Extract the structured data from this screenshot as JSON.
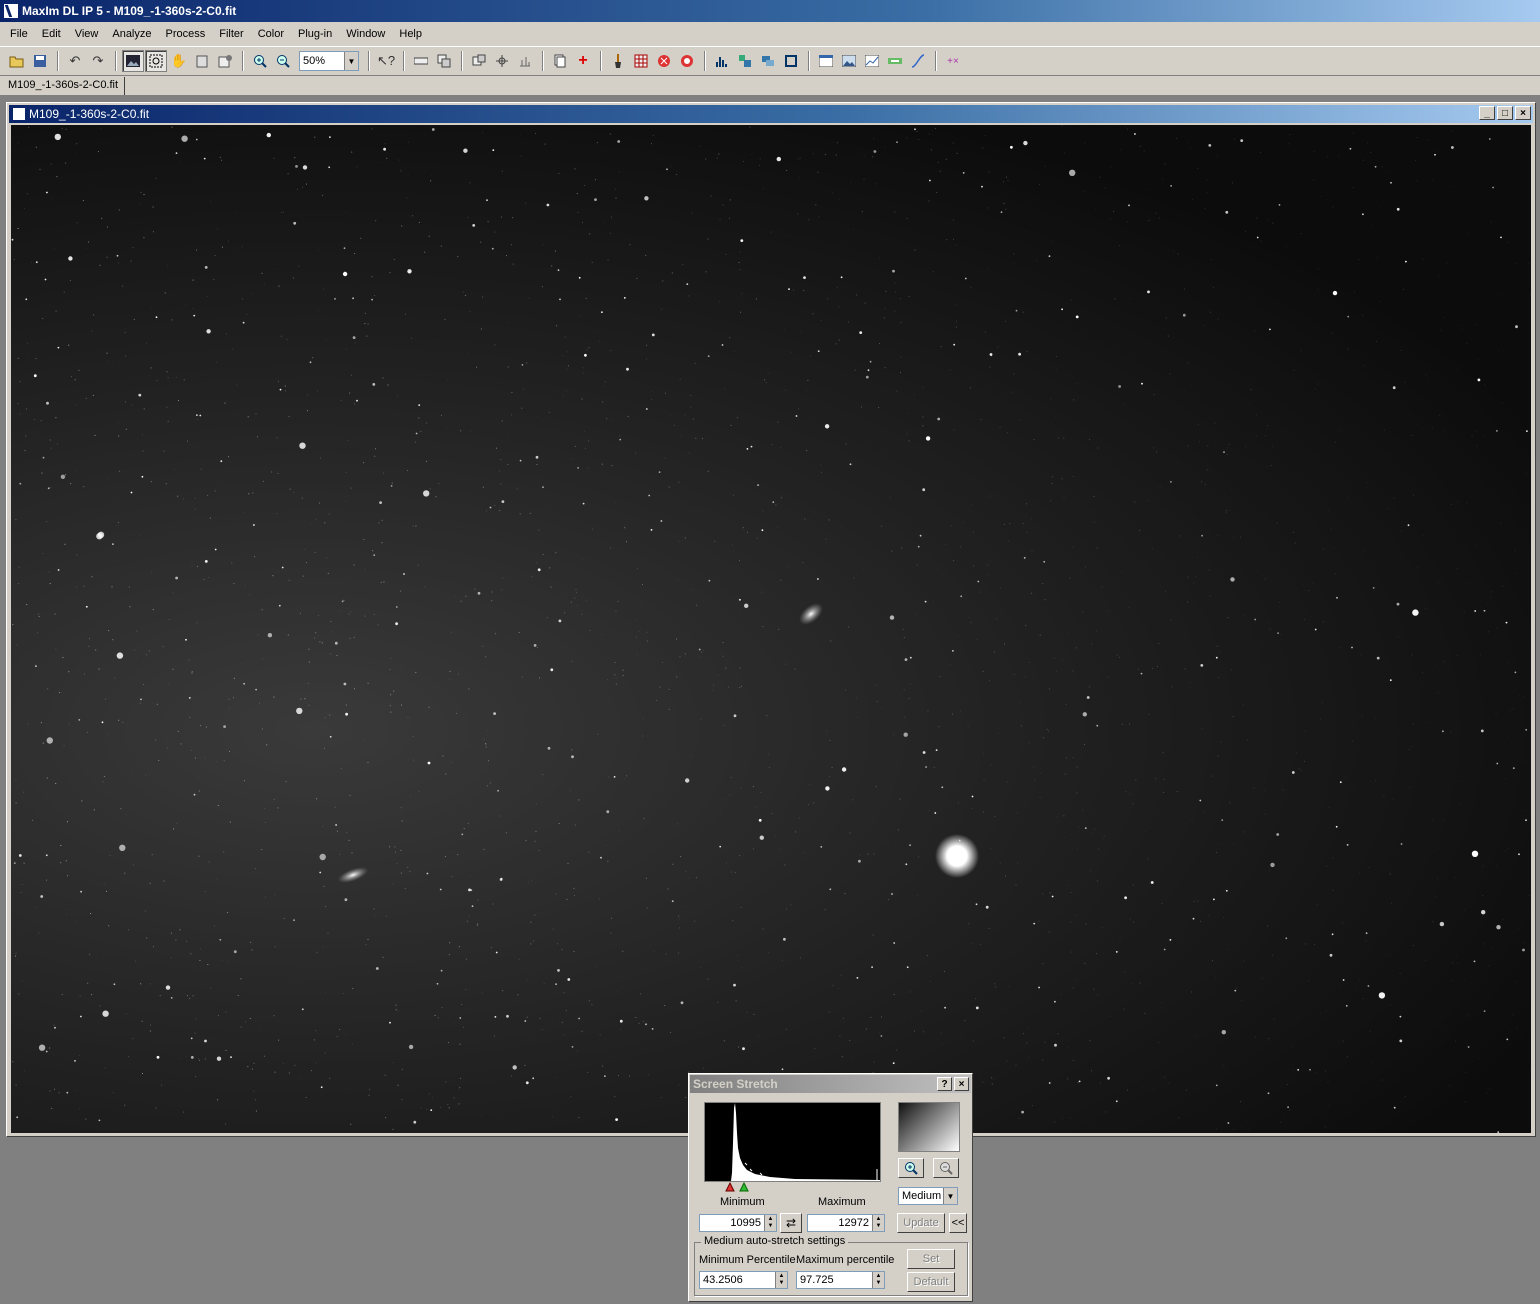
{
  "app": {
    "title": "MaxIm DL IP 5 - M109_-1-360s-2-C0.fit"
  },
  "menu": [
    "File",
    "Edit",
    "View",
    "Analyze",
    "Process",
    "Filter",
    "Color",
    "Plug-in",
    "Window",
    "Help"
  ],
  "toolbar": {
    "zoom_value": "50%"
  },
  "tabs": [
    "M109_-1-360s-2-C0.fit"
  ],
  "image_window": {
    "title": "M109_-1-360s-2-C0.fit"
  },
  "screen_stretch": {
    "title": "Screen Stretch",
    "help_label": "?",
    "close_label": "×",
    "minimum_label": "Minimum",
    "maximum_label": "Maximum",
    "minimum_value": "10995",
    "maximum_value": "12972",
    "mode": "Medium",
    "update_label": "Update",
    "collapse_label": "<<",
    "group_label": "Medium auto-stretch settings",
    "min_percentile_label": "Minimum Percentile",
    "max_percentile_label": "Maximum percentile",
    "min_percentile_value": "43.2506",
    "max_percentile_value": "97.725",
    "set_label": "Set",
    "default_label": "Default"
  },
  "icons": {
    "open": "folder-open-icon",
    "save": "save-icon",
    "undo": "undo-icon",
    "redo": "redo-icon",
    "zoom_in": "zoom-in-icon",
    "zoom_out": "zoom-out-icon",
    "help": "context-help-icon"
  }
}
